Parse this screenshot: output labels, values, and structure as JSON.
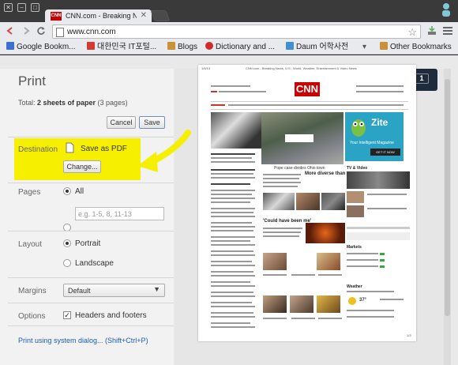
{
  "browser": {
    "tab_title": "CNN.com - Breaking News",
    "favicon_text": "CNN",
    "url": "www.cnn.com",
    "close_glyph": "✕",
    "nav_icons": [
      "back-icon",
      "forward-icon",
      "reload-icon"
    ]
  },
  "bookmarks": {
    "items": [
      {
        "label": "Google Bookm...",
        "icon": "google-icon",
        "color": "#3b6fd4"
      },
      {
        "label": "대한민국 IT포털...",
        "icon": "site-e-icon",
        "color": "#d23b2f"
      },
      {
        "label": "Blogs",
        "icon": "folder-icon",
        "color": "#c8913a"
      },
      {
        "label": "Dictionary and ...",
        "icon": "globe-icon",
        "color": "#d12b2b"
      },
      {
        "label": "Daum 어학사전",
        "icon": "daum-icon",
        "color": "#3f8fd2"
      }
    ],
    "other": "Other Bookmarks"
  },
  "print": {
    "title": "Print",
    "total_prefix": "Total: ",
    "total_sheets": "2 sheets of paper",
    "total_suffix": " (3 pages)",
    "cancel_label": "Cancel",
    "save_label": "Save",
    "destination": {
      "label": "Destination",
      "value": "Save as PDF",
      "change_label": "Change..."
    },
    "pages": {
      "label": "Pages",
      "all_label": "All",
      "range_placeholder": "e.g. 1-5, 8, 11-13"
    },
    "layout": {
      "label": "Layout",
      "portrait_label": "Portrait",
      "landscape_label": "Landscape"
    },
    "margins": {
      "label": "Margins",
      "value": "Default"
    },
    "options": {
      "label": "Options",
      "headers_label": "Headers and footers",
      "checked_glyph": "✓"
    },
    "system_dialog_link": "Print using system dialog... (Shift+Ctrl+P)",
    "page_indicator": "1"
  },
  "preview": {
    "logo": "CNN",
    "header_date": "1/6/13",
    "header_title": "CNN.com - Breaking News, U.S., World, Weather, Entertainment & Video News",
    "headline_1": "More diverse than ever",
    "headline_2": "'Could have been me'",
    "ad_title": "Zite",
    "ad_tagline": "Your Intelligent Magazine",
    "ad_button": "GET IT NOW",
    "photo_caption": "Pope case divides Ohio town",
    "footer_page": "1/3",
    "tv_label": "TV & Video",
    "markets_label": "Markets",
    "weather_label": "Weather",
    "temp": "37°"
  },
  "colors": {
    "annotation_arrow": "#f6f000",
    "cnn_red": "#cc0000",
    "link_blue": "#1a5fb4"
  }
}
